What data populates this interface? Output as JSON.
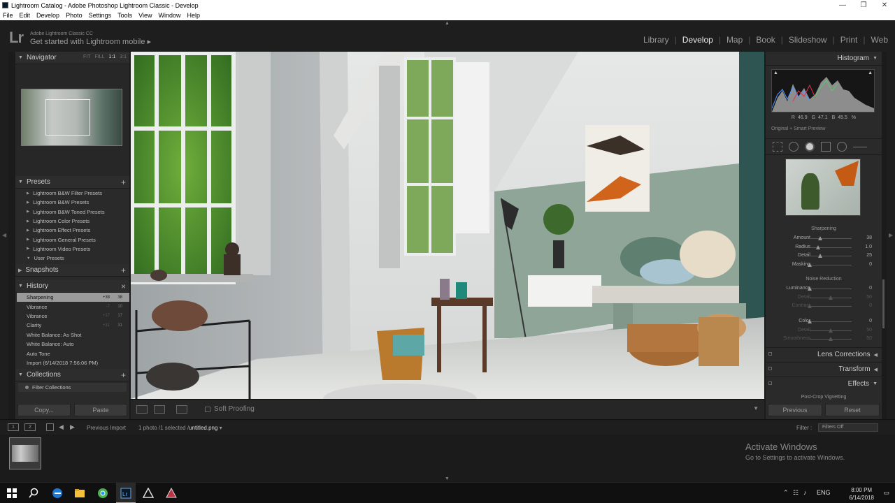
{
  "window": {
    "title": "Lightroom Catalog - Adobe Photoshop Lightroom Classic - Develop",
    "controls": [
      "—",
      "❐",
      "✕"
    ]
  },
  "menu": [
    "File",
    "Edit",
    "Develop",
    "Photo",
    "Settings",
    "Tools",
    "View",
    "Window",
    "Help"
  ],
  "header": {
    "logo": "Lr",
    "product": "Adobe Lightroom Classic CC",
    "mobile": "Get started with Lightroom mobile ▸",
    "modules": [
      "Library",
      "Develop",
      "Map",
      "Book",
      "Slideshow",
      "Print",
      "Web"
    ],
    "active_module": "Develop"
  },
  "left": {
    "navigator": {
      "title": "Navigator",
      "zoom": [
        "FIT",
        "FILL",
        "1:1",
        "3:1"
      ],
      "zoom_selected": "1:1"
    },
    "presets": {
      "title": "Presets",
      "items": [
        "Lightroom B&W Filter Presets",
        "Lightroom B&W Presets",
        "Lightroom B&W Toned Presets",
        "Lightroom Color Presets",
        "Lightroom Effect Presets",
        "Lightroom General Presets",
        "Lightroom Video Presets",
        "User Presets"
      ]
    },
    "snapshots": {
      "title": "Snapshots"
    },
    "history": {
      "title": "History",
      "items": [
        {
          "label": "Sharpening",
          "v1": "+38",
          "v2": "38"
        },
        {
          "label": "Vibrance",
          "v1": "-7",
          "v2": "10"
        },
        {
          "label": "Vibrance",
          "v1": "+17",
          "v2": "17"
        },
        {
          "label": "Clarity",
          "v1": "+31",
          "v2": "31"
        },
        {
          "label": "White Balance: As Shot",
          "v1": "",
          "v2": ""
        },
        {
          "label": "White Balance: Auto",
          "v1": "",
          "v2": ""
        },
        {
          "label": "Auto Tone",
          "v1": "",
          "v2": ""
        },
        {
          "label": "Import (6/14/2018 7:56:06 PM)",
          "v1": "",
          "v2": ""
        }
      ]
    },
    "collections": {
      "title": "Collections",
      "filter": "Filter Collections"
    },
    "copy_label": "Copy...",
    "paste_label": "Paste"
  },
  "toolbar": {
    "soft_proofing": "Soft Proofing"
  },
  "right": {
    "histogram_title": "Histogram",
    "readout": {
      "r_label": "R",
      "r": "46.9",
      "g_label": "G",
      "g": "47.1",
      "b_label": "B",
      "b": "45.5",
      "unit": "%"
    },
    "smart_preview": "Original + Smart Preview",
    "sharpening": {
      "title": "Sharpening",
      "sliders": [
        {
          "label": "Amount",
          "value": "38",
          "pos": 0.25
        },
        {
          "label": "Radius",
          "value": "1.0",
          "pos": 0.2
        },
        {
          "label": "Detail",
          "value": "25",
          "pos": 0.25
        },
        {
          "label": "Masking",
          "value": "0",
          "pos": 0.0
        }
      ]
    },
    "noise": {
      "title": "Noise Reduction",
      "sliders": [
        {
          "label": "Luminance",
          "value": "0",
          "pos": 0.0,
          "dim": false
        },
        {
          "label": "Detail",
          "value": "50",
          "pos": 0.5,
          "dim": true
        },
        {
          "label": "Contrast",
          "value": "0",
          "pos": 0.0,
          "dim": true
        },
        {
          "label": "Color",
          "value": "0",
          "pos": 0.0,
          "dim": false
        },
        {
          "label": "Detail",
          "value": "50",
          "pos": 0.5,
          "dim": true
        },
        {
          "label": "Smoothness",
          "value": "50",
          "pos": 0.5,
          "dim": true
        }
      ]
    },
    "sections": [
      "Lens Corrections",
      "Transform",
      "Effects"
    ],
    "post_crop": "Post-Crop Vignetting",
    "previous_label": "Previous",
    "reset_label": "Reset"
  },
  "filmstrip": {
    "view1": "1",
    "view2": "2",
    "source": "Previous Import",
    "count": "1 photo /1 selected /",
    "file": "untitled.png",
    "filter_label": "Filter :",
    "filter_value": "Filters Off",
    "activate_title": "Activate Windows",
    "activate_sub": "Go to Settings to activate Windows."
  },
  "taskbar": {
    "lang": "ENG",
    "time": "8:00 PM",
    "date": "6/14/2018"
  },
  "colors": {
    "accent": "#8ab4f8",
    "panel": "#2a2a2a",
    "butterfly": "#d0641a"
  }
}
